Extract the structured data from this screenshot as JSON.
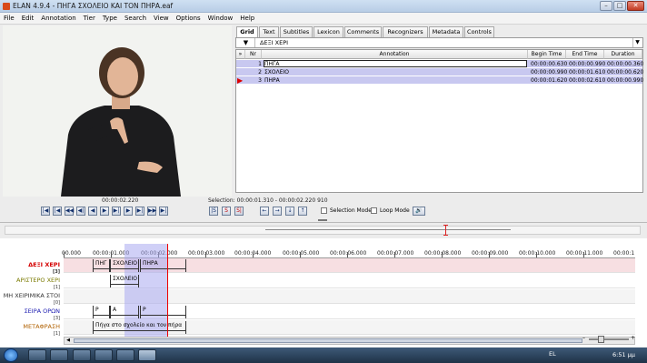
{
  "window": {
    "title": "ELAN 4.9.4 - ΠΗΓΑ ΣΧΟΛΕΙΟ ΚΑΙ ΤΟΝ ΠΗΡΑ.eaf",
    "min": "–",
    "max": "□",
    "close": "✕"
  },
  "menu": [
    "File",
    "Edit",
    "Annotation",
    "Tier",
    "Type",
    "Search",
    "View",
    "Options",
    "Window",
    "Help"
  ],
  "tabs": [
    "Grid",
    "Text",
    "Subtitles",
    "Lexicon",
    "Comments",
    "Recognizers",
    "Metadata",
    "Controls"
  ],
  "tier_selector": {
    "button": "▼",
    "value": "ΔΕΞΙ ΧΕΡΙ",
    "dropdown": "▼"
  },
  "grid": {
    "headers": [
      "»",
      "Nr",
      "Annotation",
      "Begin Time",
      "End Time",
      "Duration"
    ],
    "rows": [
      {
        "nr": "1",
        "annotation": "ΠΗΓΑ",
        "begin": "00:00:00.630",
        "end": "00:00:00.990",
        "duration": "00:00:00.360"
      },
      {
        "nr": "2",
        "annotation": "ΣΧΟΛΕΙΟ",
        "begin": "00:00:00.990",
        "end": "00:00:01.610",
        "duration": "00:00:00.620"
      },
      {
        "nr": "3",
        "annotation": "ΠΗΡΑ",
        "begin": "00:00:01.620",
        "end": "00:00:02.610",
        "duration": "00:00:00.990"
      }
    ]
  },
  "player": {
    "current_time": "00:00:02.220",
    "selection_label": "Selection: 00:00:01.310 - 00:00:02.220  910",
    "nav_buttons": [
      "|◀",
      "|◀",
      "◀◀",
      "◀|",
      "◀",
      "▶",
      "▶|",
      "▶",
      "▶|",
      "▶▶",
      "▶|"
    ],
    "sel_buttons": [
      "|S",
      "S",
      "S|"
    ],
    "arrow_buttons": [
      "←",
      "→",
      "↓",
      "↑"
    ],
    "selection_mode": "Selection Mode",
    "loop_mode": "Loop Mode",
    "volume": "🔊"
  },
  "timeline": {
    "ruler_labels": [
      "00.000",
      "00:00:01.000",
      "00:00:02.000",
      "00:00:03.000",
      "00:00:04.000",
      "00:00:05.000",
      "00:00:06.000",
      "00:00:07.000",
      "00:00:08.000",
      "00:00:09.000",
      "00:00:10.000",
      "00:00:11.000",
      "00:00:1"
    ],
    "tiers": [
      {
        "name": "ΔΕΞΙ ΧΕΡΙ",
        "count": "[3]",
        "color": "#d40000"
      },
      {
        "name": "ΑΡΙΣΤΕΡΟ ΧΕΡΙ",
        "count": "[1]",
        "color": "#7a7a00"
      },
      {
        "name": "ΜΗ ΧΕΙΡΙΜΙΚΑ ΣΤΟΙ",
        "count": "[0]",
        "color": "#333333"
      },
      {
        "name": "ΣΕΙΡΑ ΟΡΩΝ",
        "count": "[3]",
        "color": "#1a1ab0"
      },
      {
        "name": "ΜΕΤΑΦΡΑΣΗ",
        "count": "[1]",
        "color": "#b06000"
      }
    ],
    "annotations": {
      "right_hand": [
        "ΠΗΓ",
        "ΣΧΟΛΕΙΟ",
        "ΠΗΡΑ"
      ],
      "left_hand": [
        "ΣΧΟΛΕΙΟ"
      ],
      "order": [
        "P",
        "A",
        "P"
      ],
      "translation": "Πήγα στο σχολείο και τον πήρα"
    }
  },
  "taskbar": {
    "lang": "EL",
    "clock": "6:51 μμ"
  }
}
